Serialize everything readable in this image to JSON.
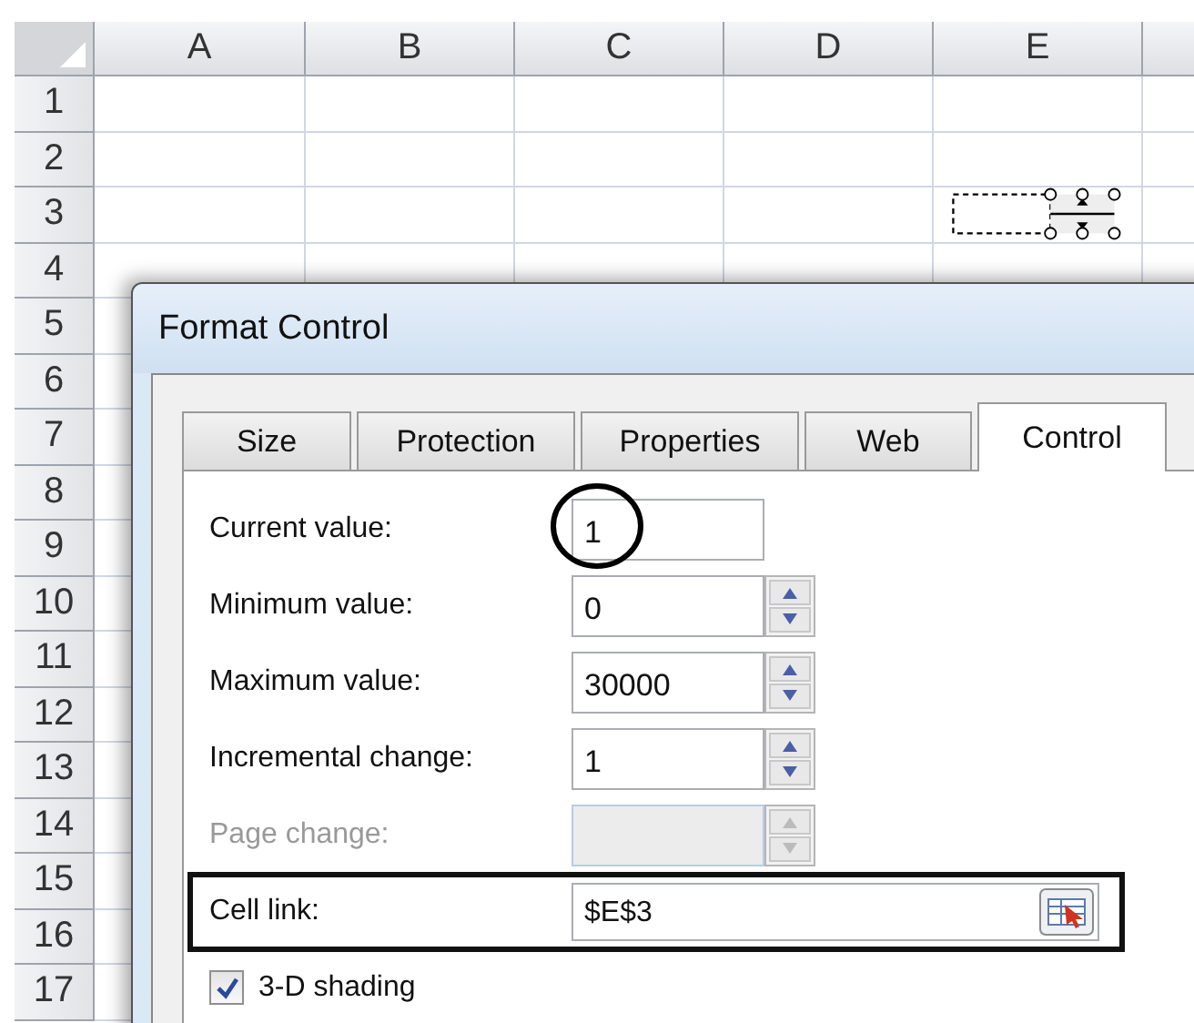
{
  "sheet": {
    "columns": [
      "A",
      "B",
      "C",
      "D",
      "E"
    ],
    "rows": [
      "1",
      "2",
      "3",
      "4",
      "5",
      "6",
      "7",
      "8",
      "9",
      "10",
      "11",
      "12",
      "13",
      "14",
      "15",
      "16",
      "17"
    ]
  },
  "dialog": {
    "title": "Format Control",
    "tabs": [
      {
        "label": "Size",
        "selected": false
      },
      {
        "label": "Protection",
        "selected": false
      },
      {
        "label": "Properties",
        "selected": false
      },
      {
        "label": "Web",
        "selected": false
      },
      {
        "label": "Control",
        "selected": true
      }
    ],
    "fields": [
      {
        "kind": "text",
        "label": "Current value:",
        "value": "1",
        "disabled": false,
        "circled": true,
        "framed": false
      },
      {
        "kind": "spin",
        "label": "Minimum value:",
        "value": "0",
        "disabled": false,
        "circled": false,
        "framed": false
      },
      {
        "kind": "spin",
        "label": "Maximum value:",
        "value": "30000",
        "disabled": false,
        "circled": false,
        "framed": false
      },
      {
        "kind": "spin",
        "label": "Incremental change:",
        "value": "1",
        "disabled": false,
        "circled": false,
        "framed": false
      },
      {
        "kind": "spin",
        "label": "Page change:",
        "disabled": true,
        "circled": false,
        "framed": false
      },
      {
        "kind": "reference",
        "label": "Cell link:",
        "value": "$E$3",
        "disabled": false,
        "circled": false,
        "framed": true
      }
    ],
    "checkbox": {
      "label": "3-D shading",
      "checked": true
    }
  }
}
